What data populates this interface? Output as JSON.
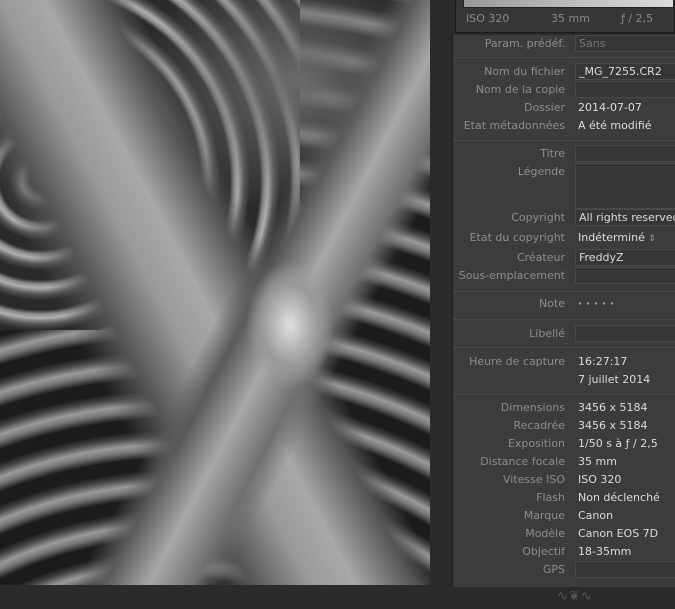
{
  "histogram_info": {
    "iso": "ISO 320",
    "focal": "35 mm",
    "aperture": "ƒ / 2,5"
  },
  "preset": {
    "label": "Param. prédéf.",
    "value": "Sans"
  },
  "file": [
    {
      "label": "Nom du fichier",
      "value": "_MG_7255.CR2",
      "field": true
    },
    {
      "label": "Nom de la copie",
      "value": "",
      "field": true
    },
    {
      "label": "Dossier",
      "value": "2014-07-07",
      "field": false
    },
    {
      "label": "Etat métadonnées",
      "value": "A été modifié",
      "field": false
    }
  ],
  "content": {
    "title_label": "Titre",
    "caption_label": "Légende",
    "copyright_label": "Copyright",
    "copyright_value": "All rights reserved",
    "copyright_status_label": "Etat du copyright",
    "copyright_status_value": "Indéterminé",
    "creator_label": "Créateur",
    "creator_value": "FreddyZ",
    "sublocation_label": "Sous-emplacement"
  },
  "rating": {
    "label": "Note",
    "stars": "·  ·  ·  ·  ·",
    "value": 0
  },
  "label": {
    "label": "Libellé",
    "value": ""
  },
  "capture": {
    "label": "Heure de capture",
    "time": "16:27:17",
    "date": "7 juillet 2014"
  },
  "exif": [
    {
      "label": "Dimensions",
      "value": "3456 x 5184"
    },
    {
      "label": "Recadrée",
      "value": "3456 x 5184"
    },
    {
      "label": "Exposition",
      "value": "1/50 s à ƒ / 2,5"
    },
    {
      "label": "Distance focale",
      "value": "35 mm"
    },
    {
      "label": "Vitesse ISO",
      "value": "ISO 320"
    },
    {
      "label": "Flash",
      "value": "Non déclenché"
    },
    {
      "label": "Marque",
      "value": "Canon"
    },
    {
      "label": "Modèle",
      "value": "Canon EOS 7D"
    },
    {
      "label": "Objectif",
      "value": "18-35mm"
    }
  ],
  "gps": {
    "label": "GPS",
    "value": ""
  }
}
